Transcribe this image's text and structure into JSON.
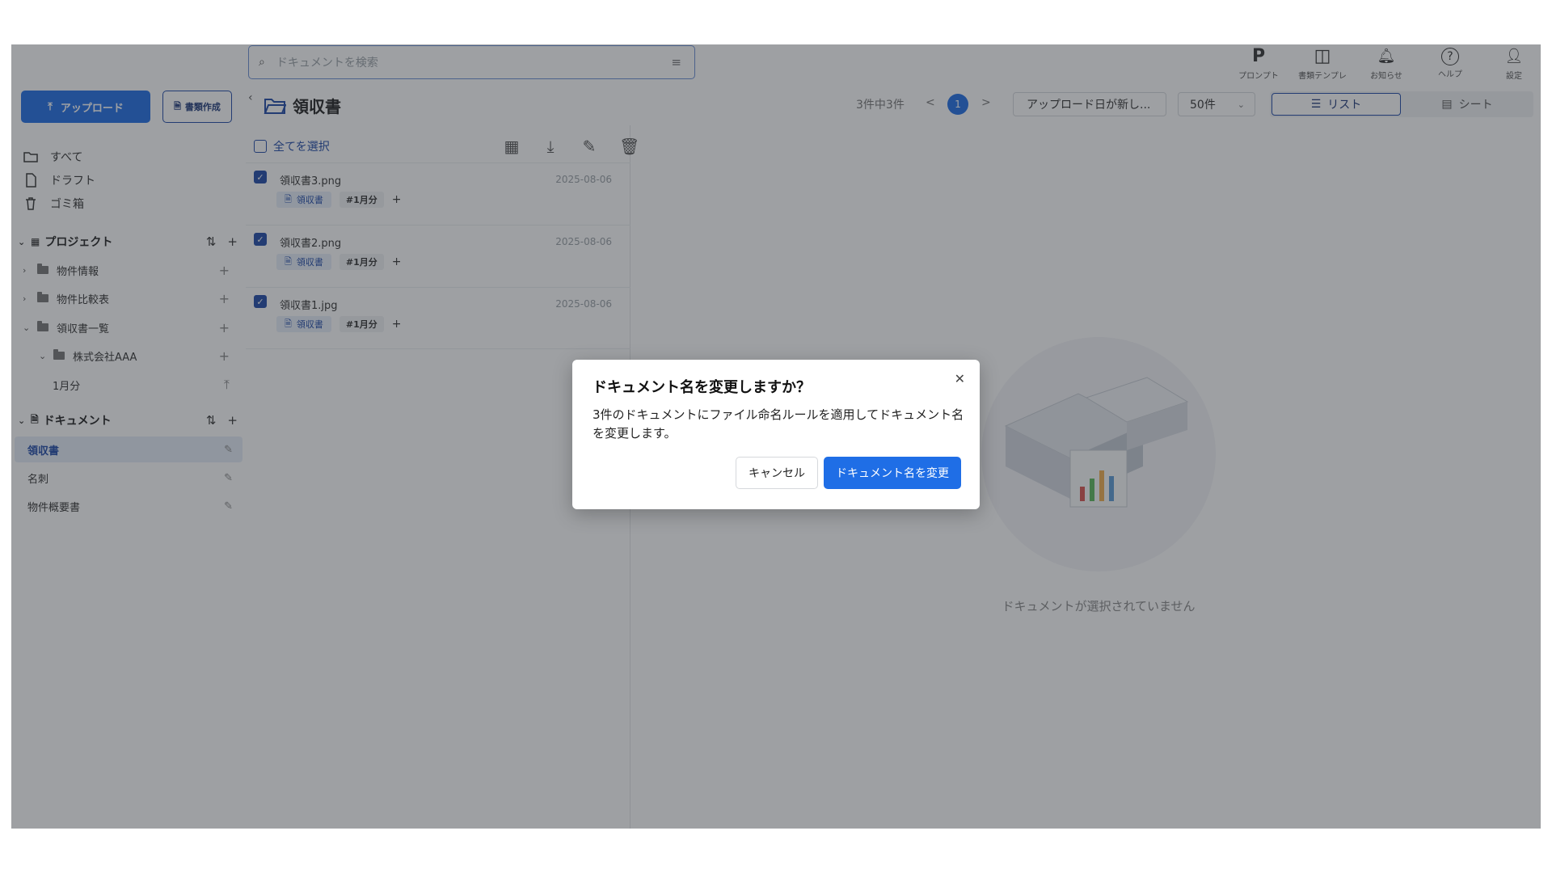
{
  "search": {
    "placeholder": "ドキュメントを検索"
  },
  "top_icons": [
    {
      "name": "prompt-icon",
      "glyph": "P",
      "label": "プロンプト"
    },
    {
      "name": "template-icon",
      "glyph": "◫",
      "label": "書類テンプレ"
    },
    {
      "name": "bell-icon",
      "glyph": "🔔︎",
      "label": "お知らせ"
    },
    {
      "name": "help-icon",
      "glyph": "?",
      "label": "ヘルプ"
    },
    {
      "name": "user-icon",
      "glyph": "👤︎",
      "label": "設定"
    }
  ],
  "sidebar": {
    "upload_label": "アップロード",
    "create_label": "書類作成",
    "nav": [
      {
        "label": "すべて",
        "icon": "folder-open-icon"
      },
      {
        "label": "ドラフト",
        "icon": "file-icon"
      },
      {
        "label": "ゴミ箱",
        "icon": "trash-icon"
      }
    ],
    "projects_title": "プロジェクト",
    "projects": [
      {
        "label": "物件情報"
      },
      {
        "label": "物件比較表"
      },
      {
        "label": "領収書一覧"
      },
      {
        "label": "株式会社AAA"
      },
      {
        "label": "1月分"
      }
    ],
    "documents_title": "ドキュメント",
    "documents": [
      {
        "label": "領収書",
        "active": true
      },
      {
        "label": "名刺",
        "active": false
      },
      {
        "label": "物件概要書",
        "active": false
      }
    ]
  },
  "header": {
    "folder_title": "領収書",
    "count_text": "3件中3件",
    "page": "1",
    "prev": "<",
    "next": ">",
    "sort_label": "アップロード日が新し...",
    "per_page": "50件",
    "view_list": "リスト",
    "view_sheet": "シート"
  },
  "list": {
    "select_all": "全てを選択",
    "rows": [
      {
        "filename": "領収書3.png",
        "date": "2025-08-06",
        "type_tag": "領収書",
        "hash_tag": "#1月分"
      },
      {
        "filename": "領収書2.png",
        "date": "2025-08-06",
        "type_tag": "領収書",
        "hash_tag": "#1月分"
      },
      {
        "filename": "領収書1.jpg",
        "date": "2025-08-06",
        "type_tag": "領収書",
        "hash_tag": "#1月分"
      }
    ]
  },
  "empty_state": {
    "text": "ドキュメントが選択されていません"
  },
  "modal": {
    "title": "ドキュメント名を変更しますか？",
    "body": "3件のドキュメントにファイル命名ルールを適用してドキュメント名を変更します。",
    "cancel": "キャンセル",
    "confirm": "ドキュメント名を変更"
  },
  "colors": {
    "accent": "#1f6ee6",
    "accent_dark": "#1f4aa8",
    "overlay": "rgba(40,44,52,0.45)"
  }
}
